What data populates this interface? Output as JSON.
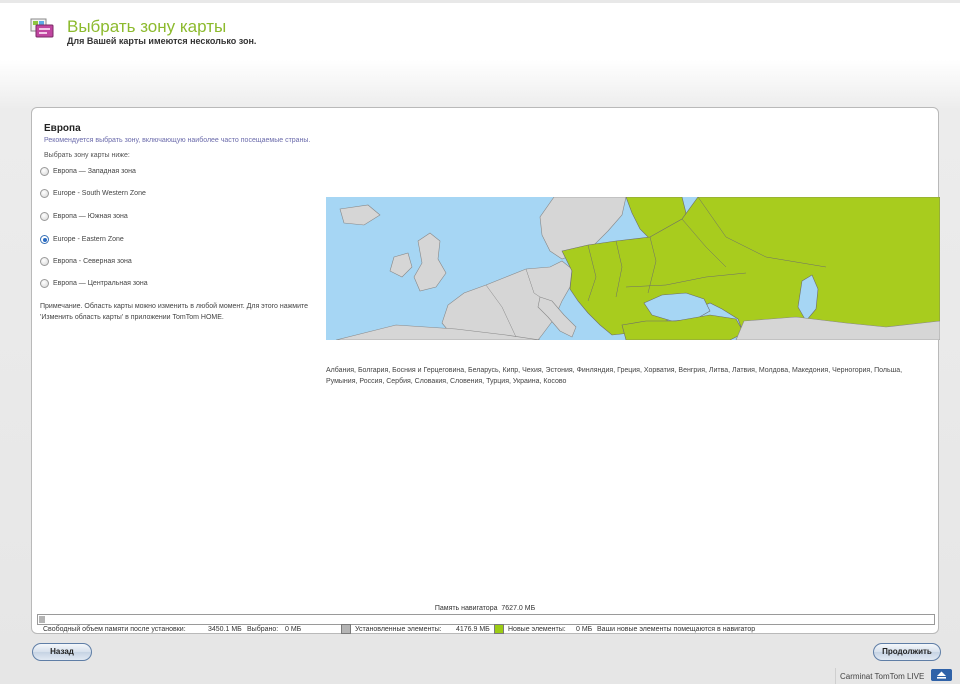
{
  "header": {
    "title": "Выбрать зону карты",
    "subtitle": "Для Вашей карты имеются несколько зон.",
    "icon": "map-zone-icon"
  },
  "region": {
    "title": "Европа",
    "recommendation": "Рекомендуется выбрать зону, включающую наиболее часто посещаемые страны.",
    "choose_label": "Выбрать зону карты ниже:",
    "zones": [
      {
        "label": "Европа — Западная зона",
        "selected": false
      },
      {
        "label": "Europe - South Western Zone",
        "selected": false
      },
      {
        "label": "Европа — Южная зона",
        "selected": false
      },
      {
        "label": "Europe - Eastern Zone",
        "selected": true
      },
      {
        "label": "Европа - Северная зона",
        "selected": false
      },
      {
        "label": "Европа — Центральная зона",
        "selected": false
      }
    ],
    "note": "Примечание. Область карты можно изменить в любой момент. Для этого нажмите 'Изменить область карты' в приложении TomTom HOME.",
    "countries": "Албания, Болгария, Босния и Герцеговина, Беларусь, Кипр, Чехия, Эстония, Финляндия, Греция, Хорватия, Венгрия, Литва, Латвия, Молдова, Македония, Черногория, Польша, Румыния, Россия, Сербия, Словакия, Словения, Турция, Украина, Косово"
  },
  "memory": {
    "label": "Память навигатора",
    "total": "7627.0 МБ",
    "installed_fraction": 0.0,
    "new_fraction": 0.0,
    "free_label": "Свободный объем памяти после установки:",
    "free_value": "3450.1 МБ",
    "selected_label": "Выбрано:",
    "selected_value": "0 МБ",
    "installed_label": "Установленные элементы:",
    "installed_value": "4176.9 МБ",
    "new_label": "Новые элементы:",
    "new_value": "0 МБ",
    "new_note": "Ваши новые элементы помещаются в навигатор"
  },
  "colors": {
    "accent_green": "#8cba2d",
    "selected_zone": "#a8cc1e",
    "sea": "#a6d6f4",
    "land": "#d6d6d6",
    "installed": "#b4b4b4",
    "new": "#9ccc14"
  },
  "buttons": {
    "back": "Назад",
    "continue": "Продолжить"
  },
  "footer": {
    "brand": "Carminat TomTom LIVE",
    "eject_icon": "eject-icon"
  }
}
